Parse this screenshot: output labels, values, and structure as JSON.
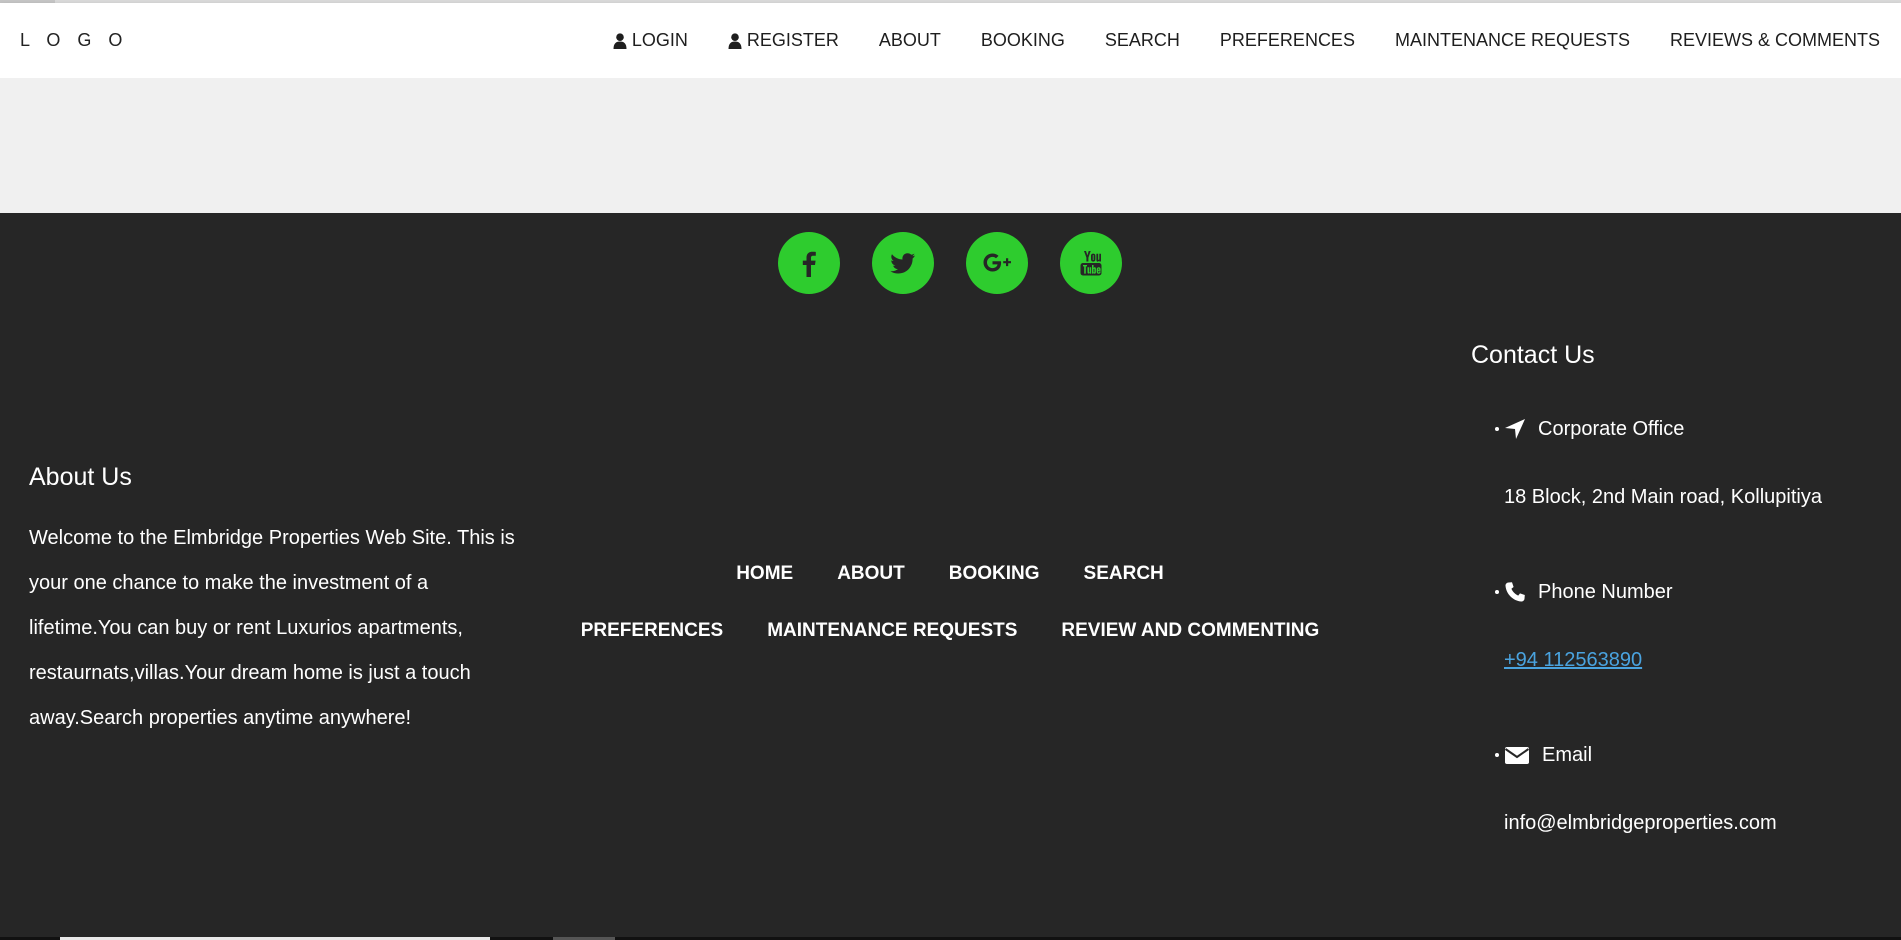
{
  "navbar": {
    "logo": "L O G O",
    "links": [
      {
        "label": "LOGIN",
        "icon": "user-icon"
      },
      {
        "label": "REGISTER",
        "icon": "user-icon"
      },
      {
        "label": "ABOUT"
      },
      {
        "label": "BOOKING"
      },
      {
        "label": "SEARCH"
      },
      {
        "label": "PREFERENCES"
      },
      {
        "label": "MAINTENANCE REQUESTS"
      },
      {
        "label": "REVIEWS & COMMENTS"
      }
    ]
  },
  "footer": {
    "social": [
      {
        "name": "facebook-icon"
      },
      {
        "name": "twitter-icon"
      },
      {
        "name": "google-plus-icon"
      },
      {
        "name": "youtube-icon"
      }
    ],
    "social_color": "#2ecc2e",
    "background": "#262626",
    "about": {
      "title": "About Us",
      "text": "Welcome to the Elmbridge Properties Web Site. This is your one chance to make the investment of a lifetime.You can buy or rent Luxurios apartments, restaurnats,villas.Your dream home is just a touch away.Search properties anytime anywhere!"
    },
    "nav_row1": [
      "HOME",
      "ABOUT",
      "BOOKING",
      "SEARCH"
    ],
    "nav_row2": [
      "PREFERENCES",
      "MAINTENANCE REQUESTS",
      "REVIEW AND COMMENTING"
    ],
    "contact": {
      "title": "Contact Us",
      "office_label": "Corporate Office",
      "office_address": "18 Block, 2nd Main road, Kollupitiya",
      "phone_label": "Phone Number",
      "phone_value": "+94 112563890",
      "email_label": "Email",
      "email_value": "info@elmbridgeproperties.com",
      "link_color": "#4aa3df"
    }
  }
}
